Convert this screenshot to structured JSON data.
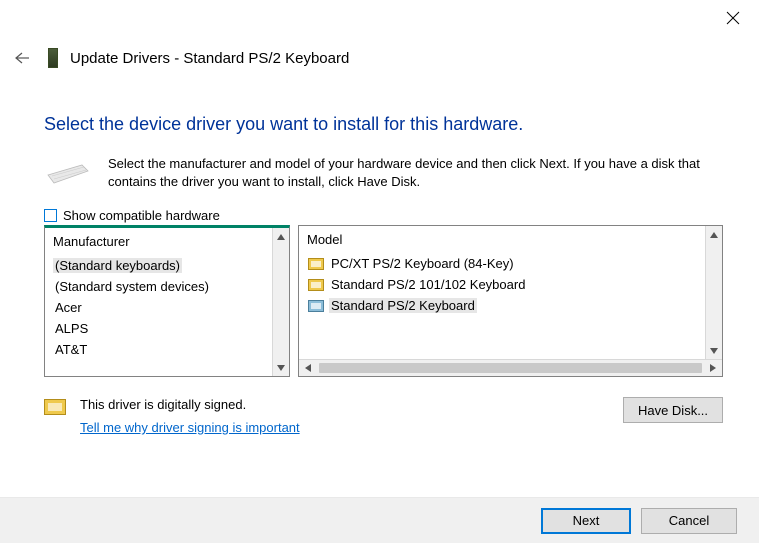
{
  "window": {
    "title": "Update Drivers - Standard PS/2 Keyboard",
    "close": "Close"
  },
  "heading": "Select the device driver you want to install for this hardware.",
  "instructions": "Select the manufacturer and model of your hardware device and then click Next. If you have a disk that contains the driver you want to install, click Have Disk.",
  "compatible": {
    "label": "Show compatible hardware",
    "checked": false
  },
  "manufacturers": {
    "header": "Manufacturer",
    "items": [
      "(Standard keyboards)",
      "(Standard system devices)",
      "Acer",
      "ALPS",
      "AT&T"
    ],
    "selected_index": 0
  },
  "models": {
    "header": "Model",
    "items": [
      "PC/XT PS/2 Keyboard (84-Key)",
      "Standard PS/2 101/102 Keyboard",
      "Standard PS/2 Keyboard"
    ],
    "selected_index": 2
  },
  "signing": {
    "status": "This driver is digitally signed.",
    "link": "Tell me why driver signing is important"
  },
  "buttons": {
    "have_disk": "Have Disk...",
    "next": "Next",
    "cancel": "Cancel"
  }
}
